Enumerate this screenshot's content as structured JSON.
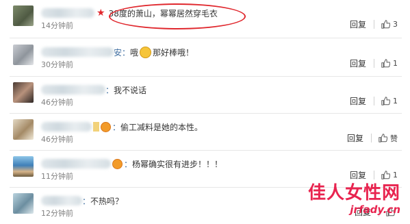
{
  "comments": [
    {
      "name_tail": "",
      "text": "38度的萧山，幂幂居然穿毛衣",
      "time": "14分钟前",
      "reply": "回复",
      "likes": "3"
    },
    {
      "name_tail": "安：",
      "text": "哦",
      "text_after": "那好棒哦！",
      "time": "30分钟前",
      "reply": "回复",
      "likes": "1"
    },
    {
      "name_tail": "：",
      "text": "我不说话",
      "time": "46分钟前",
      "reply": "回复",
      "likes": "1"
    },
    {
      "name_tail": "：",
      "text": "偷工减料是她的本性。",
      "time": "46分钟前",
      "reply": "回复",
      "likes": "赞"
    },
    {
      "name_tail": "：",
      "text": "杨幂确实很有进步！！！",
      "time": "11分钟前",
      "reply": "回复",
      "likes": "1"
    },
    {
      "name_tail": "：",
      "text": "不热吗？",
      "time": "12分钟前",
      "reply": "回复",
      "likes": ""
    }
  ],
  "watermark": {
    "title": "佳人女性网",
    "url": "jrfady.cn"
  },
  "colors": {
    "accent": "#e0282e",
    "link": "#3d6da0",
    "watermark": "#e8244f"
  }
}
